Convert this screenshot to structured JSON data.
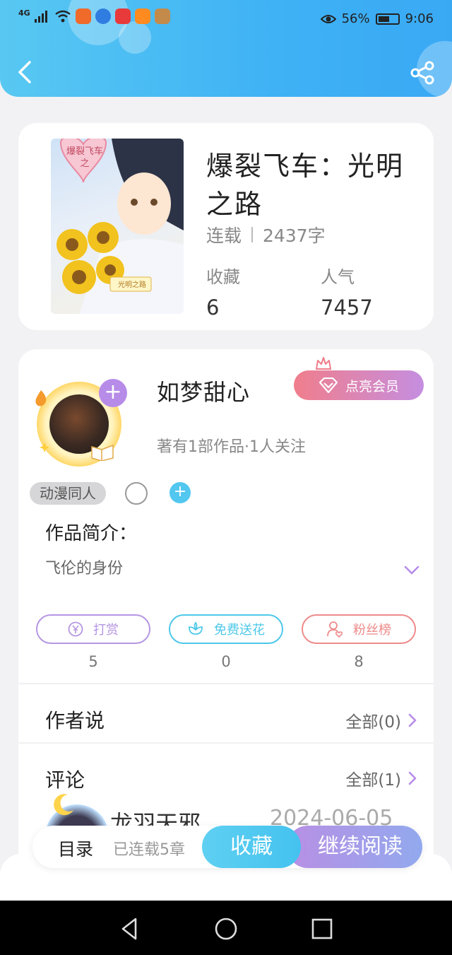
{
  "status_bar": {
    "signal": "4G",
    "battery": "56%",
    "time": "9:06"
  },
  "book": {
    "title": "爆裂飞车：光明之路",
    "status": "连载",
    "word_count": "2437字",
    "collect_label": "收藏",
    "collect_value": "6",
    "popularity_label": "人气",
    "popularity_value": "7457",
    "cover_caption_top": "爆裂飞车之",
    "cover_caption_bottom": "光明之路"
  },
  "author": {
    "name": "如梦甜心",
    "vip_button": "点亮会员",
    "desc": "著有1部作品·1人关注",
    "tag": "动漫同人",
    "avatar_plus": "+",
    "tag_add": "+"
  },
  "intro": {
    "title": "作品简介：",
    "text": "飞伦的身份"
  },
  "actions": [
    {
      "label": "打赏",
      "icon": "yen-icon",
      "count": "5",
      "color": "#b596e2"
    },
    {
      "label": "免费送花",
      "icon": "flower-icon",
      "count": "0",
      "color": "#4ec8ea"
    },
    {
      "label": "粉丝榜",
      "icon": "fan-icon",
      "count": "8",
      "color": "#ee8a8a"
    }
  ],
  "author_says": {
    "title": "作者说",
    "more": "全部(0)"
  },
  "comments": {
    "title": "评论",
    "more": "全部(1)",
    "first_user": "龙羽天邪",
    "first_date": "2024-06-05"
  },
  "bottom_bar": {
    "toc": "目录",
    "chapters": "已连载5章",
    "favorite": "收藏",
    "continue": "继续阅读"
  },
  "colors": {
    "header": "#45b8f4",
    "accent_purple": "#b78ce8",
    "accent_blue": "#4ec8ea"
  }
}
